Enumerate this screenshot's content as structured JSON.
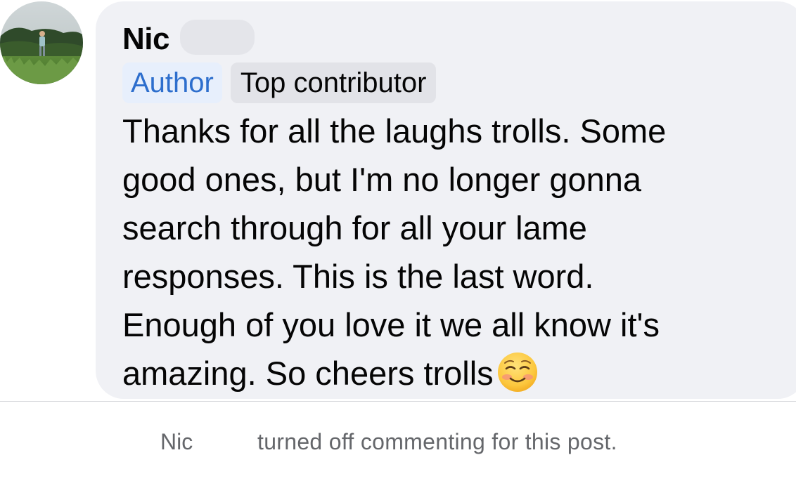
{
  "comment": {
    "author_name": "Nic",
    "author_badge": "Author",
    "contributor_badge": "Top contributor",
    "text": "Thanks for all the laughs trolls. Some\ngood ones, but I'm no longer gonna\nsearch through for all your lame\nresponses.  This is the last word.\nEnough of you love it we all know it's\namazing. So cheers trolls",
    "emoji": "smiling-face-with-blush-emoji",
    "avatar": "user-avatar-photo"
  },
  "footer": {
    "name": "Nic",
    "message": "turned off commenting for this post."
  },
  "colors": {
    "bubble_bg": "#f0f1f5",
    "author_badge_text": "#2d6ecd",
    "author_badge_bg": "#e7effc",
    "muted_text": "#65676b"
  }
}
